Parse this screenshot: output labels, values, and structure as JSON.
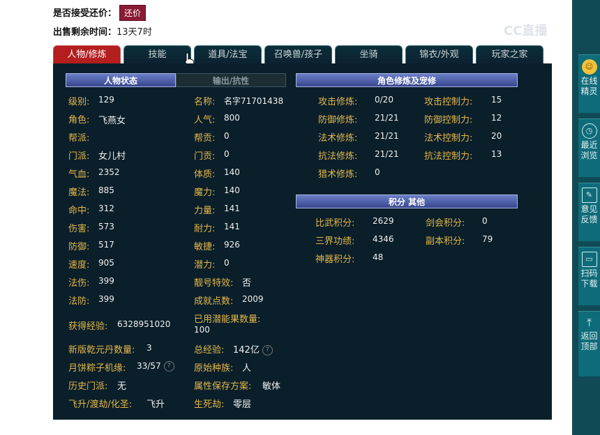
{
  "header": {
    "accept_counter_label": "是否接受还价：",
    "counter_button": "还价",
    "remaining_time_label": "出售剩余时间：",
    "remaining_time_value": "13天7时"
  },
  "watermark": "CC直播",
  "tabs": [
    "人物/修炼",
    "技能",
    "道具/法宝",
    "召唤兽/孩子",
    "坐骑",
    "锦衣/外观",
    "玩家之家"
  ],
  "section_headers": {
    "character_status": "人物状态",
    "output_resist": "输出/抗性",
    "cultivation": "角色修炼及宠修",
    "points_other": "积分 其他"
  },
  "left_col": [
    {
      "label": "级别:",
      "value": "129"
    },
    {
      "label": "角色:",
      "value": "飞燕女"
    },
    {
      "label": "帮派:",
      "value": ""
    },
    {
      "label": "门派:",
      "value": "女儿村"
    },
    {
      "label": "气血:",
      "value": "2352"
    },
    {
      "label": "魔法:",
      "value": "885"
    },
    {
      "label": "命中:",
      "value": "312"
    },
    {
      "label": "伤害:",
      "value": "573"
    },
    {
      "label": "防御:",
      "value": "517"
    },
    {
      "label": "速度:",
      "value": "905"
    },
    {
      "label": "法伤:",
      "value": "399"
    },
    {
      "label": "法防:",
      "value": "399"
    },
    {
      "label": "获得经验:",
      "value": "6328951020"
    },
    {
      "label": "新版乾元丹数量:",
      "value": "3"
    },
    {
      "label": "月饼粽子机缘:",
      "value": "33/57"
    },
    {
      "label": "历史门派:",
      "value": "无"
    },
    {
      "label": "飞升/渡劫/化圣:",
      "value": "飞升"
    }
  ],
  "mid_col": [
    {
      "label": "名称:",
      "value": "名字71701438"
    },
    {
      "label": "人气:",
      "value": "800"
    },
    {
      "label": "帮贡:",
      "value": "0"
    },
    {
      "label": "门贡:",
      "value": "0"
    },
    {
      "label": "体质:",
      "value": "140"
    },
    {
      "label": "魔力:",
      "value": "140"
    },
    {
      "label": "力量:",
      "value": "141"
    },
    {
      "label": "耐力:",
      "value": "141"
    },
    {
      "label": "敏捷:",
      "value": "926"
    },
    {
      "label": "潜力:",
      "value": "0"
    },
    {
      "label": "靓号特效:",
      "value": "否"
    },
    {
      "label": "成就点数:",
      "value": "2009"
    },
    {
      "label": "已用潜能果数量:",
      "value": "100"
    },
    {
      "label": "总经验:",
      "value": "142亿"
    },
    {
      "label": "原始种族:",
      "value": "人"
    },
    {
      "label": "属性保存方案:",
      "value": "敏体"
    },
    {
      "label": "生死劫:",
      "value": "零层"
    }
  ],
  "cultivation": [
    {
      "label": "攻击修炼:",
      "value": "0/20",
      "label2": "攻击控制力:",
      "value2": "15"
    },
    {
      "label": "防御修炼:",
      "value": "21/21",
      "label2": "防御控制力:",
      "value2": "12"
    },
    {
      "label": "法术修炼:",
      "value": "21/21",
      "label2": "法术控制力:",
      "value2": "20"
    },
    {
      "label": "抗法修炼:",
      "value": "21/21",
      "label2": "抗法控制力:",
      "value2": "13"
    },
    {
      "label": "猎术修炼:",
      "value": "0",
      "label2": "",
      "value2": ""
    }
  ],
  "points": [
    {
      "label": "比武积分:",
      "value": "2629",
      "label2": "剑会积分:",
      "value2": "0"
    },
    {
      "label": "三界功绩:",
      "value": "4346",
      "label2": "副本积分:",
      "value2": "79"
    },
    {
      "label": "神器积分:",
      "value": "48",
      "label2": "",
      "value2": ""
    }
  ],
  "sidebar": [
    {
      "icon": "avatar-icon",
      "label": "在线精灵"
    },
    {
      "icon": "clock-icon",
      "label": "最近浏览"
    },
    {
      "icon": "edit-icon",
      "label": "意见反馈"
    },
    {
      "icon": "scan-icon",
      "label": "扫码下载"
    },
    {
      "icon": "back-to-top-icon",
      "label": "返回顶部"
    }
  ]
}
